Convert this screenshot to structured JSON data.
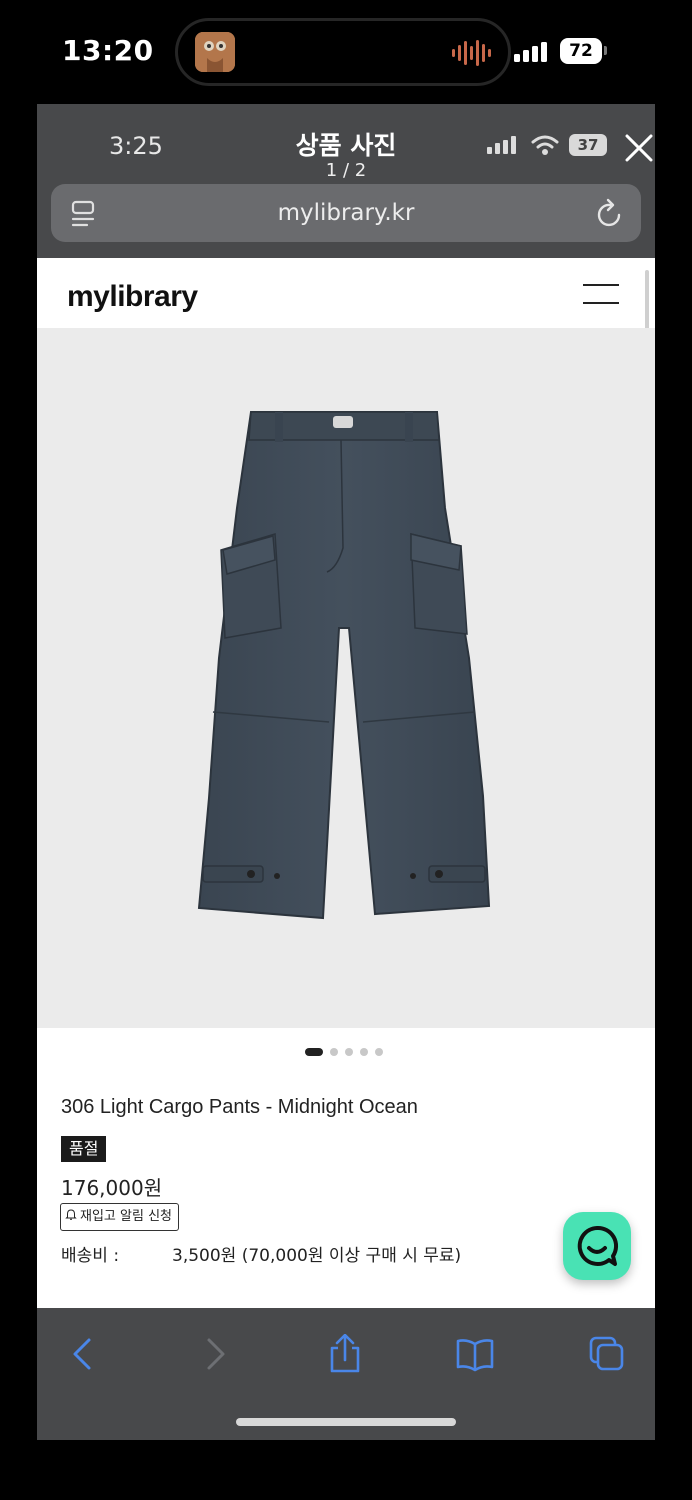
{
  "outer_status": {
    "time": "13:20",
    "battery": "72"
  },
  "viewer_status": {
    "time": "3:25",
    "battery": "37"
  },
  "viewer_header": {
    "title": "상품 사진",
    "counter": "1 / 2"
  },
  "browser": {
    "url": "mylibrary.kr"
  },
  "site": {
    "logo": "mylibrary"
  },
  "product": {
    "carousel_total": 5,
    "carousel_active": 1,
    "name": "306 Light Cargo Pants - Midnight Ocean",
    "badge": "품절",
    "price": "176,000원",
    "restock_button": "재입고 알림 신청",
    "shipping_label": "배송비 :",
    "shipping_value": "3,500원 (70,000원 이상 구매 시 무료)"
  },
  "colors": {
    "pants": "#3e4a57",
    "photo_background": "#ebebeb",
    "chat_button": "#49e2b4",
    "toolbar_icon_active": "#4a86e8"
  }
}
